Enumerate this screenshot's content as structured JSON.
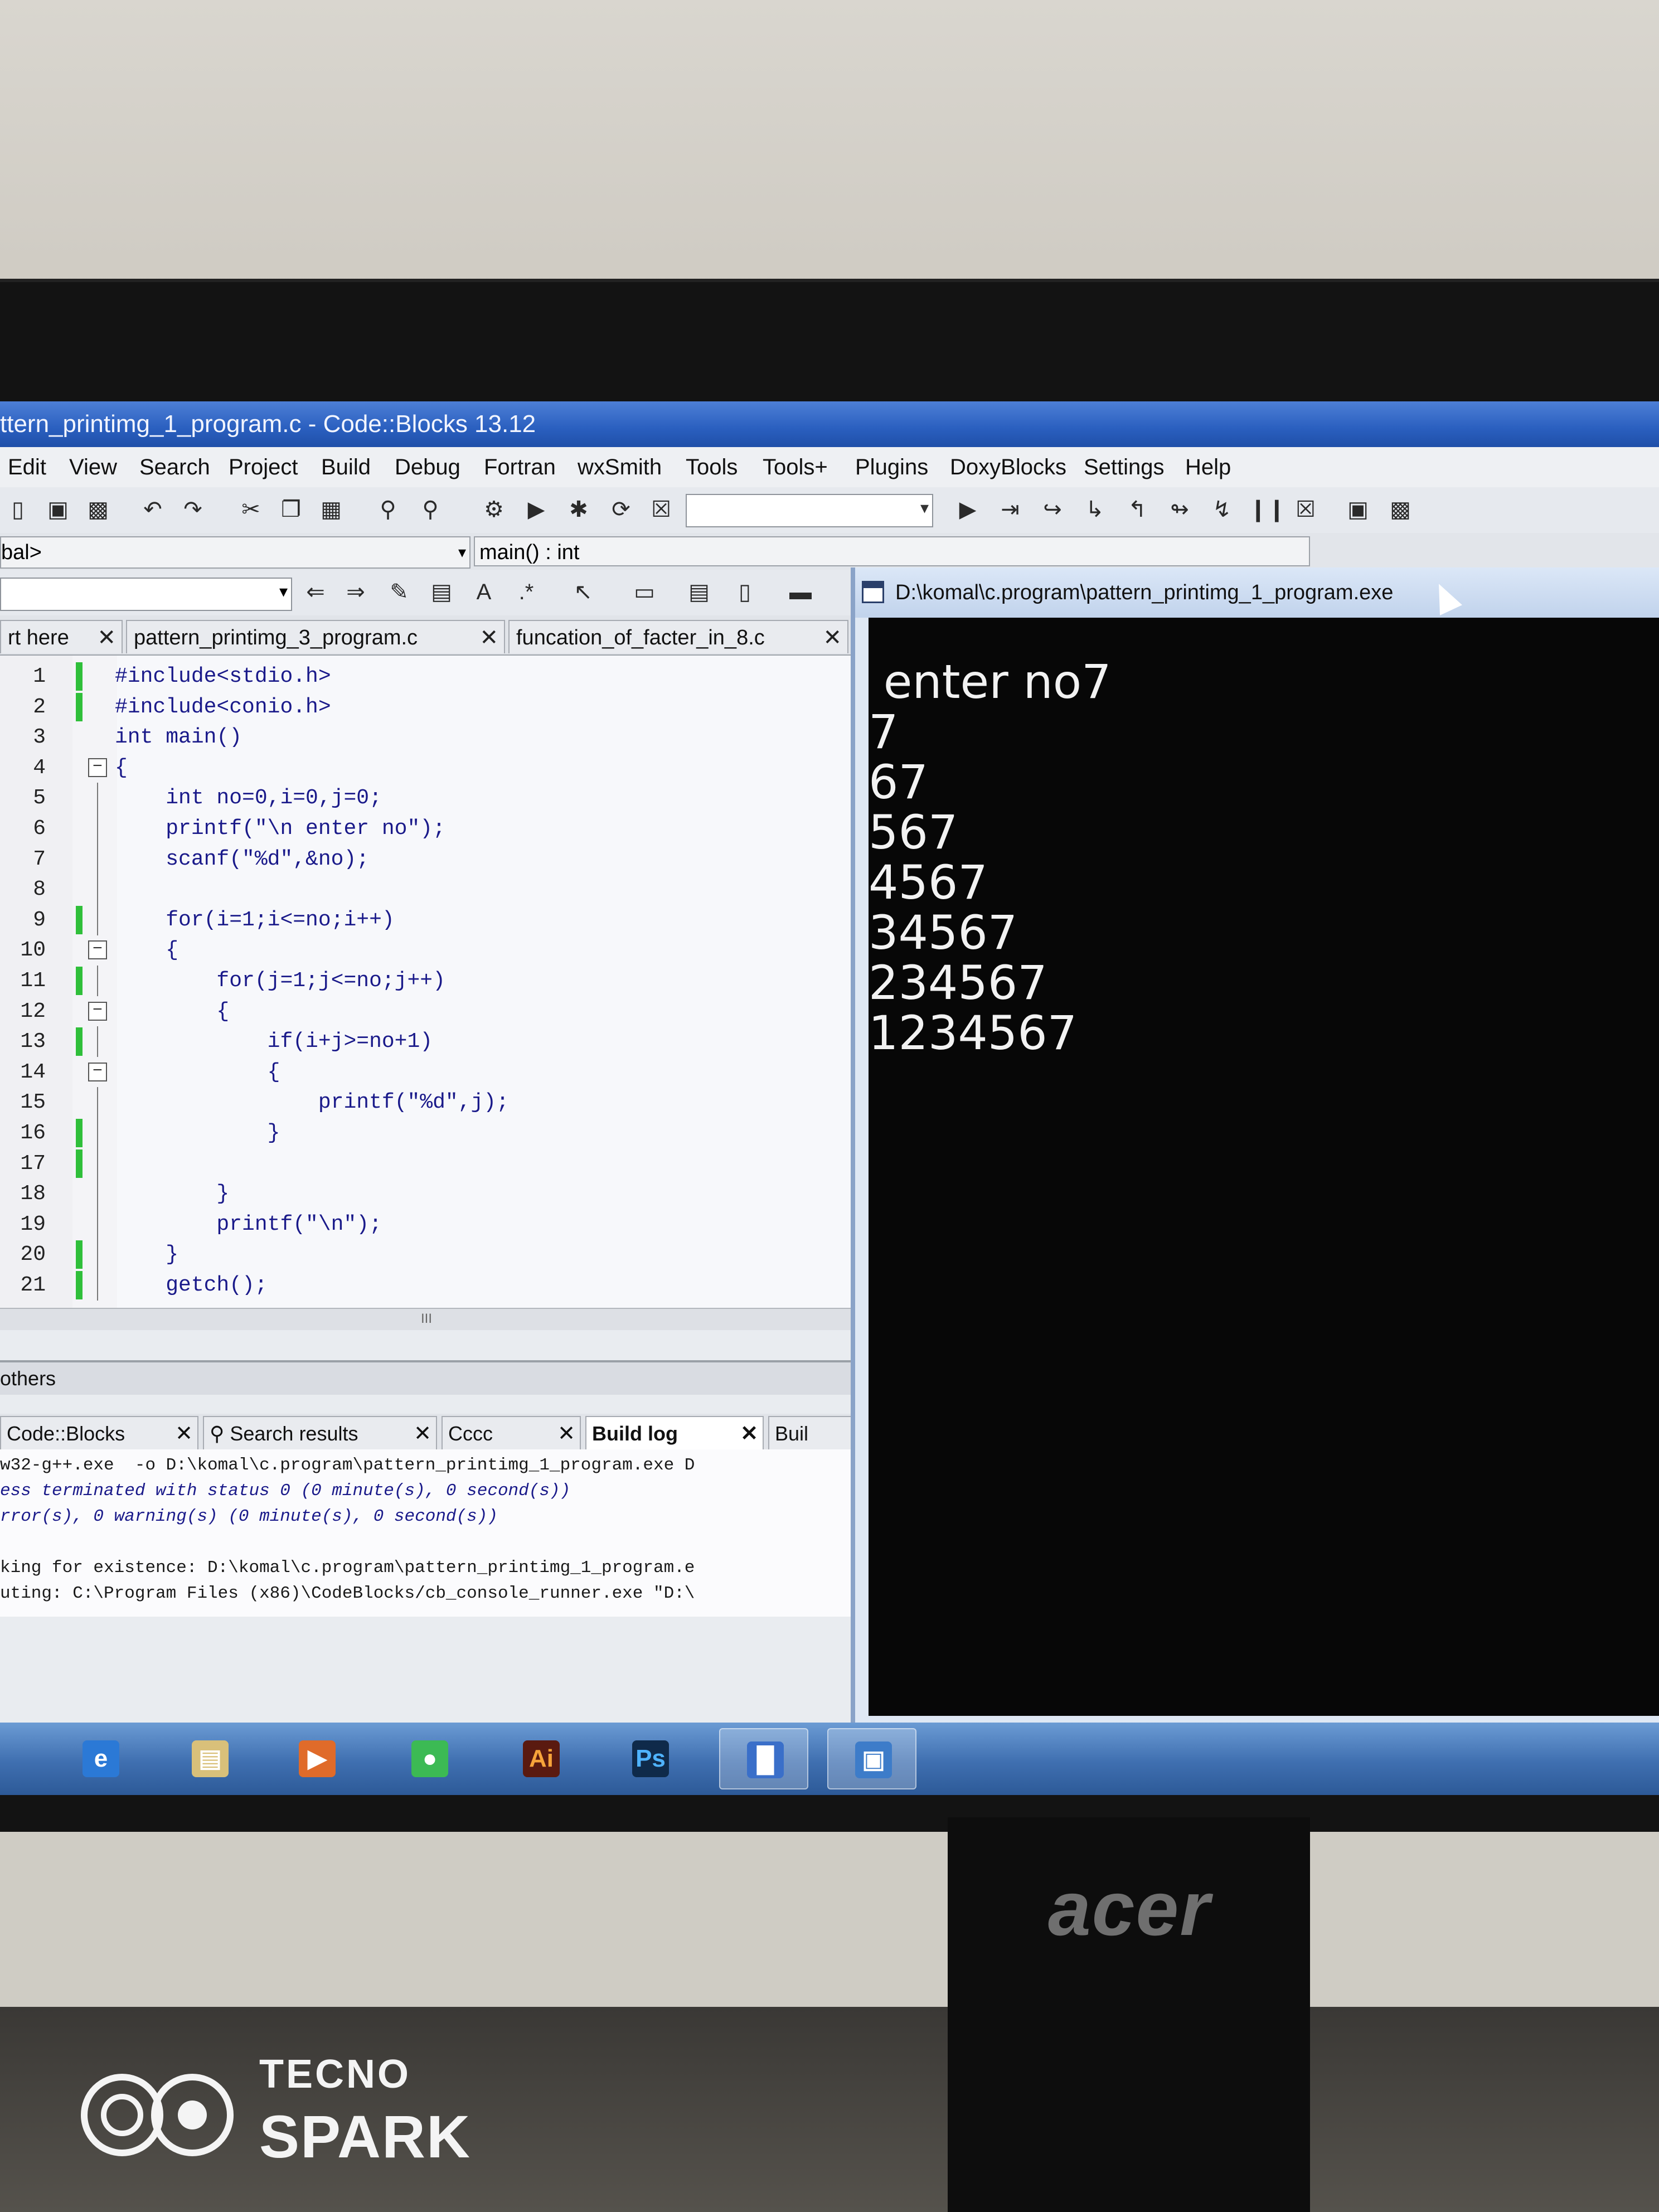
{
  "window": {
    "title": "ttern_printimg_1_program.c - Code::Blocks 13.12"
  },
  "menu": [
    "Edit",
    "View",
    "Search",
    "Project",
    "Build",
    "Debug",
    "Fortran",
    "wxSmith",
    "Tools",
    "Tools+",
    "Plugins",
    "DoxyBlocks",
    "Settings",
    "Help"
  ],
  "scope_combo": "bal>",
  "function_combo": "main() : int",
  "editor": {
    "tabs": [
      {
        "label": "rt here"
      },
      {
        "label": "pattern_printimg_3_program.c"
      },
      {
        "label": "funcation_of_facter_in_8.c"
      }
    ],
    "lines": [
      {
        "n": "1",
        "code": "#include<stdio.h>"
      },
      {
        "n": "2",
        "code": "#include<conio.h>"
      },
      {
        "n": "3",
        "code": "int main()"
      },
      {
        "n": "4",
        "code": "{"
      },
      {
        "n": "5",
        "code": "    int no=0,i=0,j=0;"
      },
      {
        "n": "6",
        "code": "    printf(\"\\n enter no\");"
      },
      {
        "n": "7",
        "code": "    scanf(\"%d\",&no);"
      },
      {
        "n": "8",
        "code": ""
      },
      {
        "n": "9",
        "code": "    for(i=1;i<=no;i++)"
      },
      {
        "n": "10",
        "code": "    {"
      },
      {
        "n": "11",
        "code": "        for(j=1;j<=no;j++)"
      },
      {
        "n": "12",
        "code": "        {"
      },
      {
        "n": "13",
        "code": "            if(i+j>=no+1)"
      },
      {
        "n": "14",
        "code": "            {"
      },
      {
        "n": "15",
        "code": "                printf(\"%d\",j);"
      },
      {
        "n": "16",
        "code": "            }"
      },
      {
        "n": "17",
        "code": ""
      },
      {
        "n": "18",
        "code": "        }"
      },
      {
        "n": "19",
        "code": "        printf(\"\\n\");"
      },
      {
        "n": "20",
        "code": "    }"
      },
      {
        "n": "21",
        "code": "    getch();"
      }
    ],
    "hscroll_grip": "III"
  },
  "logs": {
    "header": "others",
    "tabs": [
      {
        "label": "Code::Blocks"
      },
      {
        "label": "Search results"
      },
      {
        "label": "Cccc"
      },
      {
        "label": "Build log"
      },
      {
        "label": "Buil"
      }
    ],
    "lines": [
      "w32-g++.exe  -o D:\\komal\\c.program\\pattern_printimg_1_program.exe D",
      "ess terminated with status 0 (0 minute(s), 0 second(s))",
      "rror(s), 0 warning(s) (0 minute(s), 0 second(s))",
      "",
      "king for existence: D:\\komal\\c.program\\pattern_printimg_1_program.e",
      "uting: C:\\Program Files (x86)\\CodeBlocks/cb_console_runner.exe \"D:\\"
    ]
  },
  "console": {
    "title": "D:\\komal\\c.program\\pattern_printimg_1_program.exe",
    "lines": [
      " enter no7",
      "7",
      "67",
      "567",
      "4567",
      "34567",
      "234567",
      "1234567"
    ]
  },
  "taskbar": {
    "apps": [
      {
        "icon": "internet-explorer-icon"
      },
      {
        "icon": "file-explorer-icon"
      },
      {
        "icon": "media-player-icon"
      },
      {
        "icon": "chrome-icon"
      },
      {
        "icon": "illustrator-icon",
        "label": "Ai"
      },
      {
        "icon": "photoshop-icon",
        "label": "Ps"
      },
      {
        "icon": "codeblocks-icon"
      },
      {
        "icon": "console-window-icon"
      }
    ]
  },
  "monitor": {
    "brand": "acer"
  },
  "watermark": {
    "line1": "TECNO",
    "line2": "SPARK"
  },
  "colors": {
    "titlebar": "#2a5fbf",
    "console_bg": "#070707",
    "console_text": "#f2f2f2",
    "code_text": "#1a1a8a",
    "change_bar": "#2fbf3a"
  }
}
